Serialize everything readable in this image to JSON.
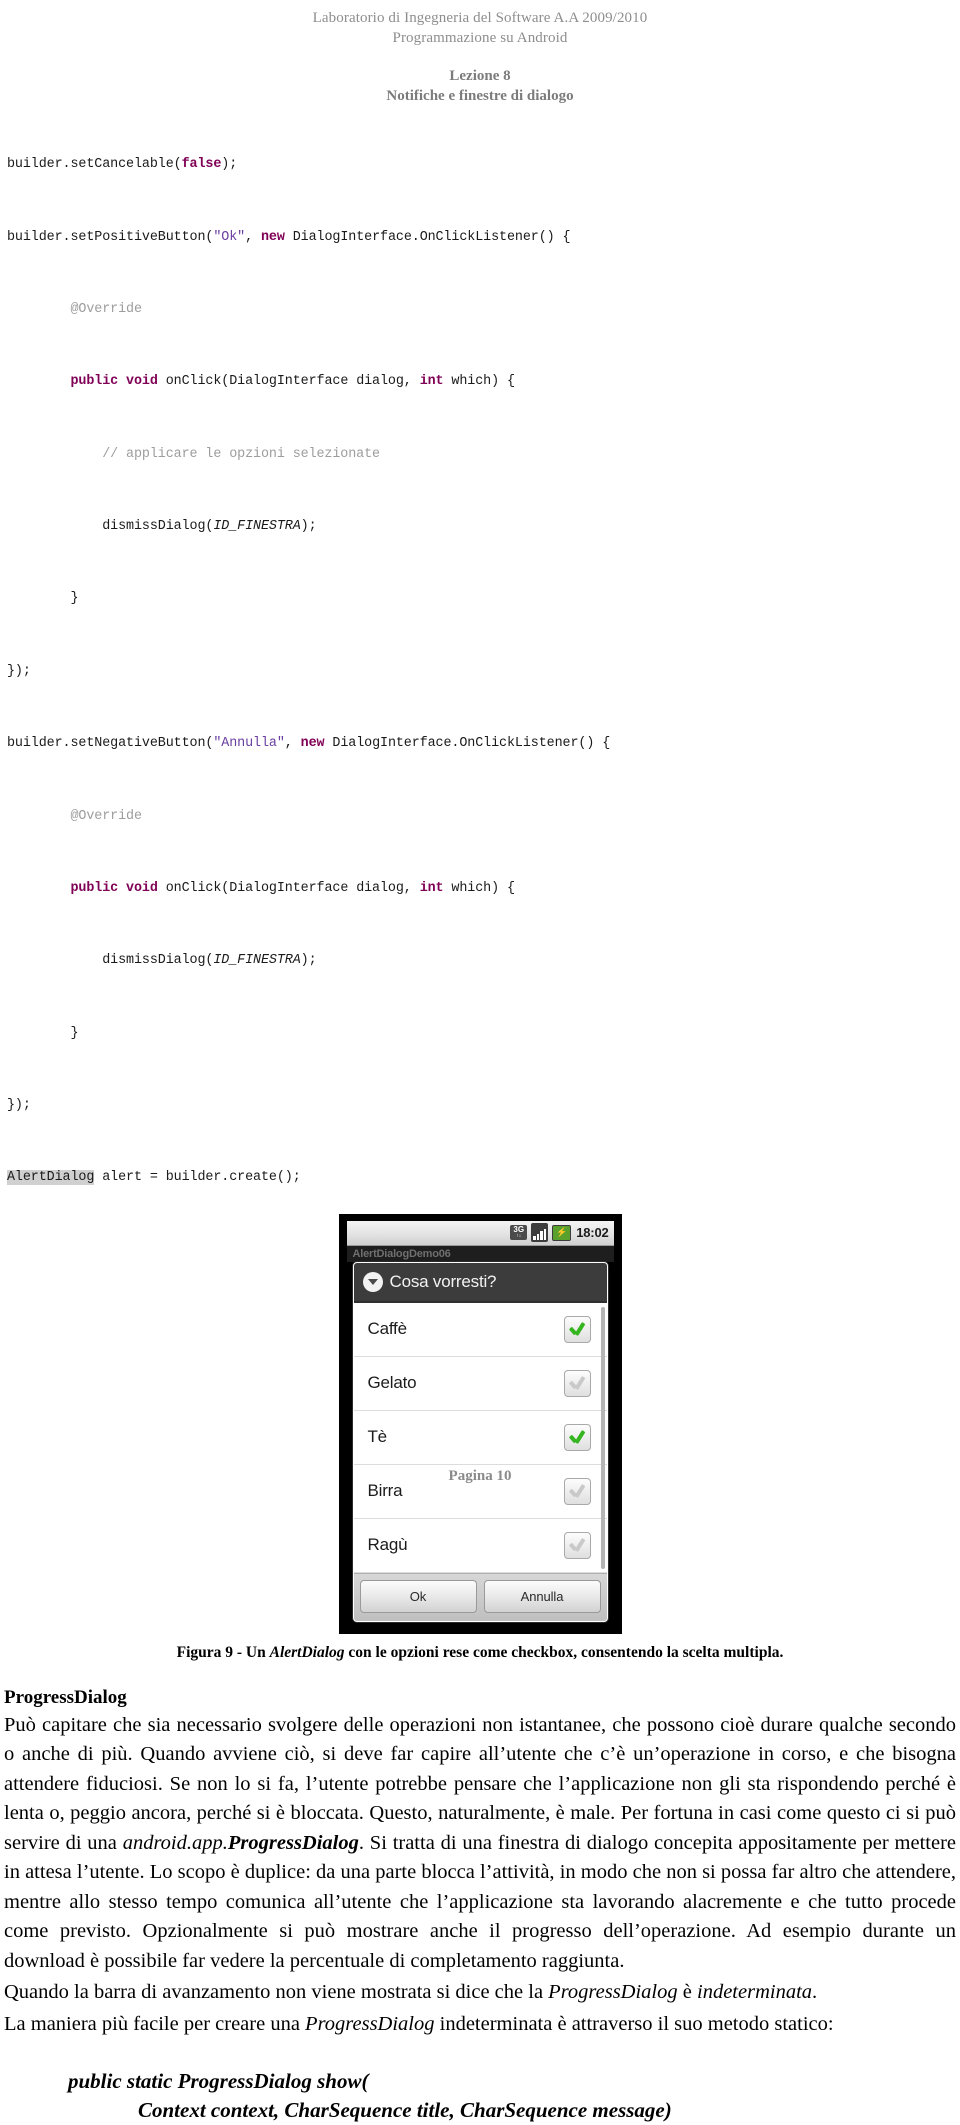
{
  "header": {
    "course": "Laboratorio di Ingegneria del Software A.A 2009/2010",
    "topic": "Programmazione su Android",
    "lesson": "Lezione 8",
    "lesson_subtitle": "Notifiche e finestre di dialogo"
  },
  "code": {
    "l1_a": "builder.setCancelable(",
    "l1_kw": "false",
    "l1_b": ");",
    "l2_a": "builder.setPositiveButton(",
    "l2_str": "\"Ok\"",
    "l2_b": ", ",
    "l2_kw": "new",
    "l2_c": " DialogInterface.OnClickListener() {",
    "l3_ann": "@Override",
    "l4_kw1": "public void",
    "l4_a": " onClick(DialogInterface dialog, ",
    "l4_kw2": "int",
    "l4_b": " which) {",
    "l5_cmt": "// applicare le opzioni selezionate",
    "l6_a": "dismissDialog(",
    "l6_it": "ID_FINESTRA",
    "l6_b": ");",
    "l7": "}",
    "l8": "});",
    "l9_a": "builder.setNegativeButton(",
    "l9_str": "\"Annulla\"",
    "l9_b": ", ",
    "l9_kw": "new",
    "l9_c": " DialogInterface.OnClickListener() {",
    "l10_ann": "@Override",
    "l11_kw1": "public void",
    "l11_a": " onClick(DialogInterface dialog, ",
    "l11_kw2": "int",
    "l11_b": " which) {",
    "l12_a": "dismissDialog(",
    "l12_it": "ID_FINESTRA",
    "l12_b": ");",
    "l13": "}",
    "l14": "});",
    "l15_hl": "AlertDialog",
    "l15_rest": " alert = builder.create();"
  },
  "phone": {
    "status": {
      "network": "3G",
      "network_sub": "↑↓",
      "battery": "⚡",
      "clock": "18:02"
    },
    "app_title": "AlertDialogDemo06",
    "dialog": {
      "title": "Cosa vorresti?",
      "title_icon": "circle-down-arrow-icon",
      "options": [
        {
          "label": "Caffè",
          "checked": true
        },
        {
          "label": "Gelato",
          "checked": false
        },
        {
          "label": "Tè",
          "checked": true
        },
        {
          "label": "Birra",
          "checked": false
        },
        {
          "label": "Ragù",
          "checked": false
        }
      ],
      "positive_button": "Ok",
      "negative_button": "Annulla"
    }
  },
  "figure_caption": {
    "pre": "Figura 9 - Un ",
    "em": "AlertDialog",
    "post": " con le opzioni rese come checkbox, consentendo la scelta multipla."
  },
  "section": {
    "title": "ProgressDialog",
    "p1_part1": "Può capitare che sia necessario svolgere delle operazioni non istantanee, che possono cioè durare qualche secondo o anche di più. Quando avviene ciò, si deve far capire all’utente che c’è un’operazione in corso, e che bisogna attendere fiduciosi. Se non lo si fa, l’utente potrebbe pensare che l’applicazione non gli sta rispondendo perché è lenta o, peggio ancora, perché si è bloccata. Questo, naturalmente, è male. Per fortuna in casi come questo ci si può servire di una ",
    "p1_em_plain": "android.app.",
    "p1_em_bold": "ProgressDialog",
    "p1_part2": ". Si tratta di una finestra di dialogo concepita appositamente per mettere in attesa l’utente. Lo scopo è duplice: da una parte blocca l’attività, in modo che non si possa far altro che attendere, mentre allo stesso tempo comunica all’utente che l’applicazione sta lavorando alacremente e che tutto procede come previsto. Opzionalmente si può mostrare anche il progresso dell’operazione. Ad esempio durante un download è possibile far vedere la percentuale di completamento raggiunta.",
    "p2_part1": "Quando la barra di avanzamento non viene mostrata si dice che la ",
    "p2_em1": "ProgressDialog",
    "p2_part2": " è ",
    "p2_em2": "indeterminata",
    "p2_part3": ".",
    "p3_part1": "La maniera più facile per creare una ",
    "p3_em1": "ProgressDialog",
    "p3_part2": " indeterminata è attraverso il suo metodo statico:"
  },
  "signature": {
    "line1": "public static ProgressDialog show(",
    "line2": "Context context, CharSequence title, CharSequence message)"
  },
  "footer": {
    "page": "Pagina 10"
  }
}
